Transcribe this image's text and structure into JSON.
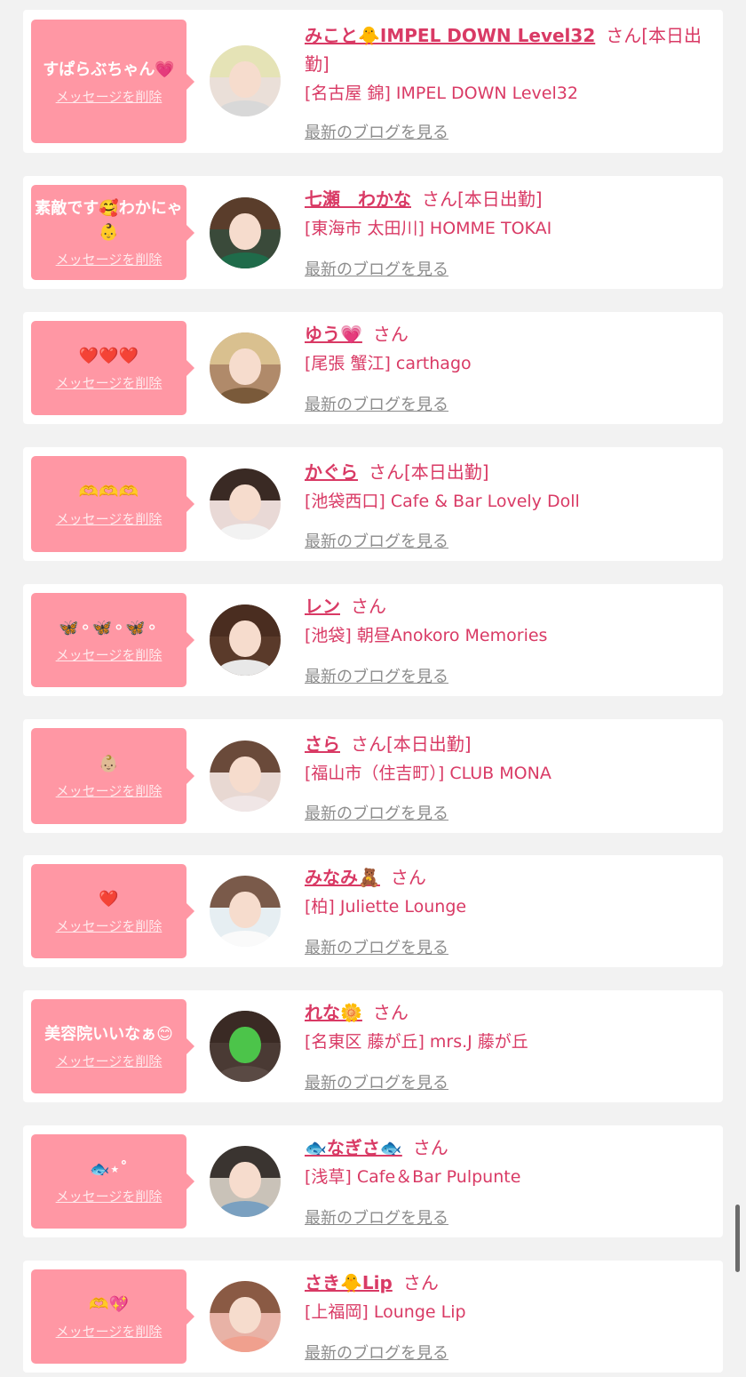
{
  "delete_label": "メッセージを削除",
  "blog_label": "最新のブログを見る",
  "san_label": "さん",
  "accent_color": "#d93a65",
  "bubble_color": "#ff97a4",
  "items": [
    {
      "message": "すぱらぶちゃん💗",
      "name": "みこと🐥IMPEL DOWN Level32",
      "suffix": "[本日出勤]",
      "shop": "[名古屋 錦] IMPEL DOWN Level32"
    },
    {
      "message": "素敵です🥰わかにゃ👶",
      "name": "七瀬　わかな",
      "suffix": "[本日出勤]",
      "shop": "[東海市 太田川] HOMME TOKAI"
    },
    {
      "message": "❤️❤️❤️",
      "name": "ゆう💗",
      "suffix": "",
      "shop": "[尾張 蟹江] carthago"
    },
    {
      "message": "🫶🫶🫶",
      "name": "かぐら",
      "suffix": "[本日出勤]",
      "shop": "[池袋西口] Cafe & Bar Lovely Doll"
    },
    {
      "message": "🦋⚬🦋⚬🦋⚬",
      "name": "レン",
      "suffix": "",
      "shop": "[池袋] 朝昼Anokoro Memories"
    },
    {
      "message": "👶🏼",
      "name": "さら",
      "suffix": "[本日出勤]",
      "shop": "[福山市（住吉町）] CLUB MONA"
    },
    {
      "message": "❤️",
      "name": "みなみ🧸",
      "suffix": "",
      "shop": "[柏] Juliette Lounge"
    },
    {
      "message": "美容院いいなぁ😊",
      "name": "れな🌼",
      "suffix": "",
      "shop": "[名東区 藤が丘] mrs.J 藤が丘"
    },
    {
      "message": "🐟⋆˚",
      "name": "🐟なぎさ🐟",
      "suffix": "",
      "shop": "[浅草] Cafe＆Bar Pulpunte"
    },
    {
      "message": "🫶💖",
      "name": "さき🐥Lip",
      "suffix": "",
      "shop": "[上福岡] Lounge Lip"
    }
  ]
}
